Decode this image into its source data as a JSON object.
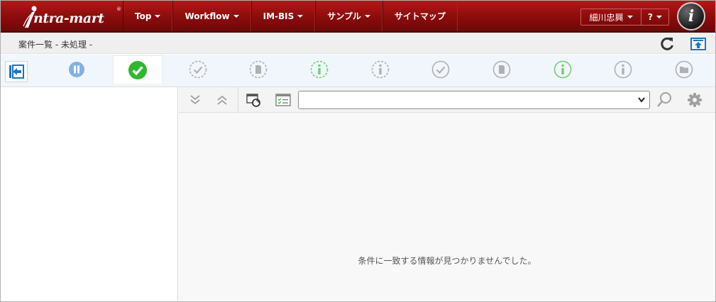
{
  "brand": {
    "logo_text": "ntra-mart",
    "reg": "®"
  },
  "nav": {
    "items": [
      {
        "label": "Top",
        "has_caret": true
      },
      {
        "label": "Workflow",
        "has_caret": true
      },
      {
        "label": "IM-BIS",
        "has_caret": true
      },
      {
        "label": "サンプル",
        "has_caret": true
      },
      {
        "label": "サイトマップ",
        "has_caret": false
      }
    ]
  },
  "user": {
    "name": "細川忠興",
    "help_label": "?"
  },
  "header": {
    "page_title": "案件一覧 - 未処理 -"
  },
  "strip": {
    "tabs": [
      {
        "icon": "pause-icon",
        "active": false,
        "color": "#7fb2e5"
      },
      {
        "icon": "check-circle-icon",
        "active": true,
        "color": "#2eb82e"
      },
      {
        "icon": "check-dashed-icon",
        "active": false,
        "color": "#b0b0b0"
      },
      {
        "icon": "document-dashed-icon",
        "active": false,
        "color": "#b0b0b0"
      },
      {
        "icon": "info-dashed-green-icon",
        "active": false,
        "color": "#6fd06f"
      },
      {
        "icon": "info-dashed-icon",
        "active": false,
        "color": "#b0b0b0"
      },
      {
        "icon": "check-outline-icon",
        "active": false,
        "color": "#b0b0b0"
      },
      {
        "icon": "document-outline-icon",
        "active": false,
        "color": "#b0b0b0"
      },
      {
        "icon": "info-green-icon",
        "active": false,
        "color": "#6fd06f"
      },
      {
        "icon": "info-outline-icon",
        "active": false,
        "color": "#b0b0b0"
      },
      {
        "icon": "folder-outline-icon",
        "active": false,
        "color": "#b0b0b0"
      }
    ]
  },
  "toolbar": {
    "select_value": ""
  },
  "content": {
    "empty_message": "条件に一致する情報が見つかりませんでした。"
  },
  "colors": {
    "header": "#8b0c0c",
    "accent": "#1a74c8",
    "active_check": "#2eb82e"
  }
}
